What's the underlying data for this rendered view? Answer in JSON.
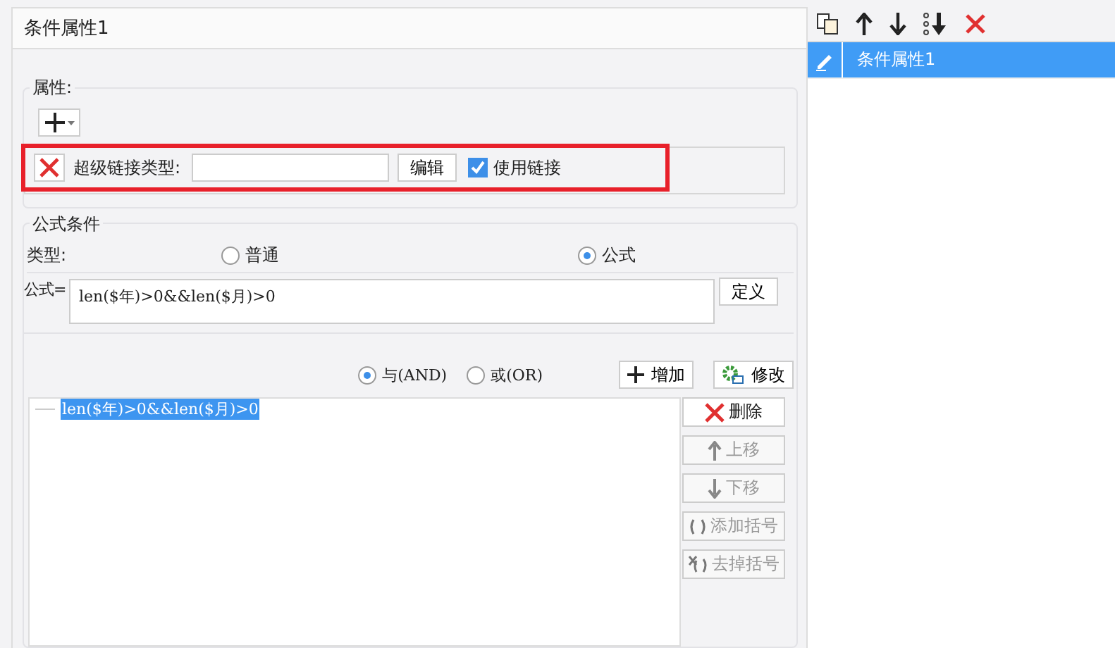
{
  "dialog": {
    "title": "条件属性1"
  },
  "properties": {
    "legend": "属性:",
    "highlighted": true,
    "row": {
      "label": "超级链接类型:",
      "edit_button": "编辑",
      "use_link": {
        "label": "使用链接",
        "checked": true
      }
    }
  },
  "formula_condition": {
    "legend": "公式条件",
    "type_label": "类型:",
    "type_options": [
      {
        "label": "普通",
        "selected": false
      },
      {
        "label": "公式",
        "selected": true
      }
    ],
    "formula_label": "公式=",
    "formula": "len($年)>0&&len($月)>0",
    "define_button": "定义",
    "logic": [
      {
        "label": "与(AND)",
        "selected": true
      },
      {
        "label": "或(OR)",
        "selected": false
      }
    ],
    "add_button": "增加",
    "modify_button": "修改",
    "conditions": [
      {
        "text": "len($年)>0&&len($月)>0",
        "selected": true
      }
    ],
    "side_buttons": [
      {
        "kind": "delete",
        "label": "删除",
        "disabled": false
      },
      {
        "kind": "up",
        "label": "上移",
        "disabled": true
      },
      {
        "kind": "down",
        "label": "下移",
        "disabled": true
      },
      {
        "kind": "add-brackets",
        "label": "添加括号",
        "disabled": true
      },
      {
        "kind": "remove-brackets",
        "label": "去掉括号",
        "disabled": true
      }
    ]
  },
  "list_panel": {
    "items": [
      {
        "label": "条件属性1",
        "selected": true
      }
    ]
  }
}
